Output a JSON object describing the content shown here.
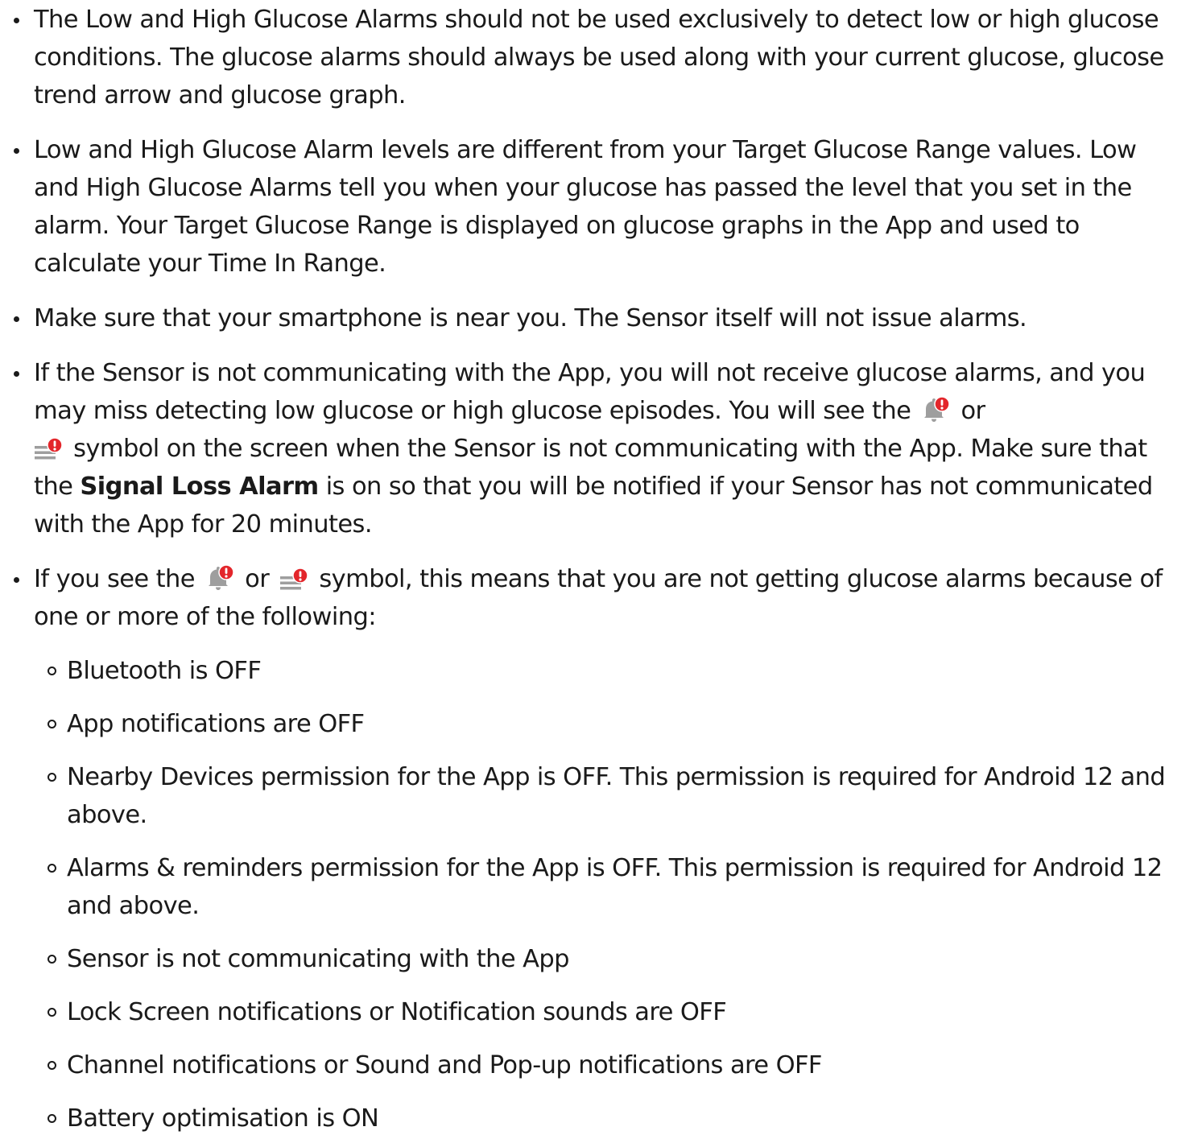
{
  "bullets": [
    {
      "text": "The Low and High Glucose Alarms should not be used exclusively to detect low or high glucose conditions. The glucose alarms should always be used along with your current glucose, glucose trend arrow and glucose graph."
    },
    {
      "text": "Low and High Glucose Alarm levels are different from your Target Glucose Range values. Low and High Glucose Alarms tell you when your glucose has passed the level that you set in the alarm. Your Target Glucose Range is displayed on glucose graphs in the App and used to calculate your Time In Range."
    },
    {
      "text": "Make sure that your smartphone is near you. The Sensor itself will not issue alarms."
    },
    {
      "part1": "If the Sensor is not communicating with the App, you will not receive glucose alarms, and you may miss detecting low glucose or high glucose episodes. You will see the",
      "part2": "or",
      "part3": "symbol on the screen when the Sensor is not communicating with the App. Make sure that the",
      "bold": "Signal Loss Alarm",
      "part4": "is on so that you will be notified if your Sensor has not communicated with the App for 20 minutes."
    },
    {
      "part1": "If you see the",
      "part2": "or",
      "part3": "symbol, this means that you are not getting glucose alarms because of one or more of the following:",
      "sub": [
        "Bluetooth is OFF",
        "App notifications are OFF",
        "Nearby Devices permission for the App is OFF. This permission is required for Android 12 and above.",
        "Alarms & reminders permission for the App is OFF. This permission is required for Android 12 and above.",
        "Sensor is not communicating with the App",
        "Lock Screen notifications or Notification sounds are OFF",
        "Channel notifications or Sound and Pop-up notifications are OFF",
        "Battery optimisation is ON"
      ]
    }
  ],
  "icons": {
    "bell": "bell-alert-icon",
    "lines": "lines-alert-icon",
    "alert_color": "#e3262b",
    "icon_color": "#9e9e9e"
  }
}
